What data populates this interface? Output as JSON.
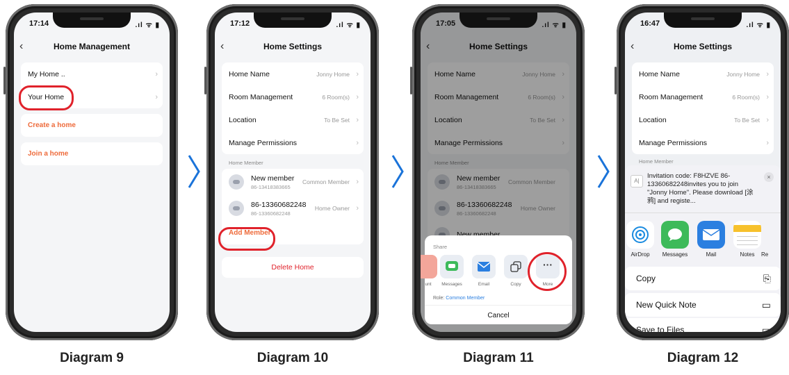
{
  "captions": [
    "Diagram 9",
    "Diagram 10",
    "Diagram 11",
    "Diagram 12"
  ],
  "phone1": {
    "time": "17:14",
    "title": "Home Management",
    "homes": [
      "My Home ..",
      "Your Home"
    ],
    "create_home": "Create a home",
    "join_home": "Join a home"
  },
  "phone2": {
    "time": "17:12",
    "title": "Home Settings",
    "settings": [
      {
        "label": "Home Name",
        "value": "Jonny Home"
      },
      {
        "label": "Room Management",
        "value": "6 Room(s)"
      },
      {
        "label": "Location",
        "value": "To Be Set"
      },
      {
        "label": "Manage Permissions",
        "value": ""
      }
    ],
    "member_section": "Home Member",
    "members": [
      {
        "name": "New member",
        "phone": "86-13418383665",
        "role": "Common Member"
      },
      {
        "name": "86-13360682248",
        "phone": "86-13360682248",
        "role": "Home Owner"
      }
    ],
    "add_member": "Add Member",
    "delete_home": "Delete Home"
  },
  "phone3": {
    "time": "17:05",
    "title": "Home Settings",
    "settings": [
      {
        "label": "Home Name",
        "value": "Jonny Home"
      },
      {
        "label": "Room Management",
        "value": "6 Room(s)"
      },
      {
        "label": "Location",
        "value": "To Be Set"
      },
      {
        "label": "Manage Permissions",
        "value": ""
      }
    ],
    "member_section": "Home Member",
    "members": [
      {
        "name": "New member",
        "phone": "86-13418383665",
        "role": "Common Member"
      },
      {
        "name": "86-13360682248",
        "phone": "86-13360682248",
        "role": "Home Owner"
      },
      {
        "name": "New member",
        "phone": "",
        "role": ""
      }
    ],
    "share": {
      "title": "Share",
      "items": [
        "unt",
        "Messages",
        "Email",
        "Copy",
        "More"
      ],
      "role_label": "Role:",
      "role_value": "Common Member",
      "cancel": "Cancel"
    }
  },
  "phone4": {
    "time": "16:47",
    "title": "Home Settings",
    "settings": [
      {
        "label": "Home Name",
        "value": "Jonny Home"
      },
      {
        "label": "Room Management",
        "value": "6 Room(s)"
      },
      {
        "label": "Location",
        "value": "To Be Set"
      },
      {
        "label": "Manage Permissions",
        "value": ""
      }
    ],
    "member_section": "Home Member",
    "invite_text": "Invitation code: F8HZVE 86-13360682248invites you to join \"Jonny Home\". Please download [涂鸦] and registe...",
    "apps": [
      "AirDrop",
      "Messages",
      "Mail",
      "Notes",
      "Re"
    ],
    "actions": [
      "Copy",
      "New Quick Note",
      "Save to Files"
    ]
  },
  "colors": {
    "accent_orange": "#ee6b3b",
    "highlight_red": "#e0222b",
    "arrow_blue": "#1a73d9",
    "link_blue": "#2b7fe0"
  }
}
